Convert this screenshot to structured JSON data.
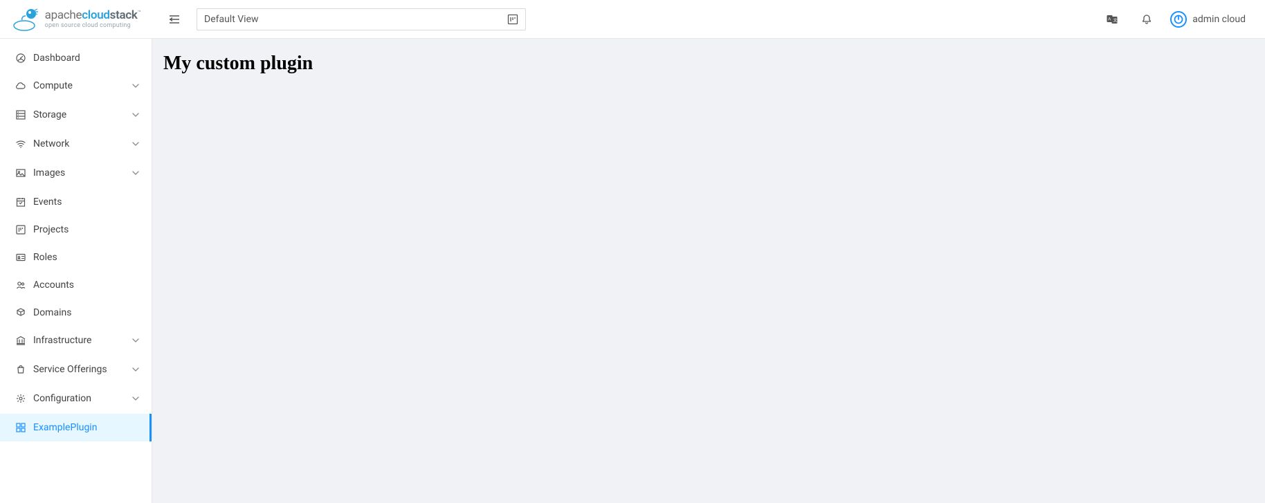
{
  "logo": {
    "part1": "apache",
    "part2": "cloud",
    "part3": "stack",
    "tagline": "open source cloud computing",
    "tm": "™"
  },
  "header": {
    "view_label": "Default View",
    "user_name": "admin cloud"
  },
  "sidebar": {
    "items": [
      {
        "label": "Dashboard",
        "icon": "dashboard-icon",
        "expandable": false
      },
      {
        "label": "Compute",
        "icon": "cloud-icon",
        "expandable": true
      },
      {
        "label": "Storage",
        "icon": "storage-icon",
        "expandable": true
      },
      {
        "label": "Network",
        "icon": "wifi-icon",
        "expandable": true
      },
      {
        "label": "Images",
        "icon": "picture-icon",
        "expandable": true
      },
      {
        "label": "Events",
        "icon": "calendar-icon",
        "expandable": false
      },
      {
        "label": "Projects",
        "icon": "project-icon",
        "expandable": false
      },
      {
        "label": "Roles",
        "icon": "idcard-icon",
        "expandable": false
      },
      {
        "label": "Accounts",
        "icon": "team-icon",
        "expandable": false
      },
      {
        "label": "Domains",
        "icon": "block-icon",
        "expandable": false
      },
      {
        "label": "Infrastructure",
        "icon": "bank-icon",
        "expandable": true
      },
      {
        "label": "Service Offerings",
        "icon": "shopping-icon",
        "expandable": true
      },
      {
        "label": "Configuration",
        "icon": "settings-icon",
        "expandable": true
      },
      {
        "label": "ExamplePlugin",
        "icon": "appstore-icon",
        "expandable": false,
        "active": true
      }
    ]
  },
  "main": {
    "title": "My custom plugin"
  }
}
